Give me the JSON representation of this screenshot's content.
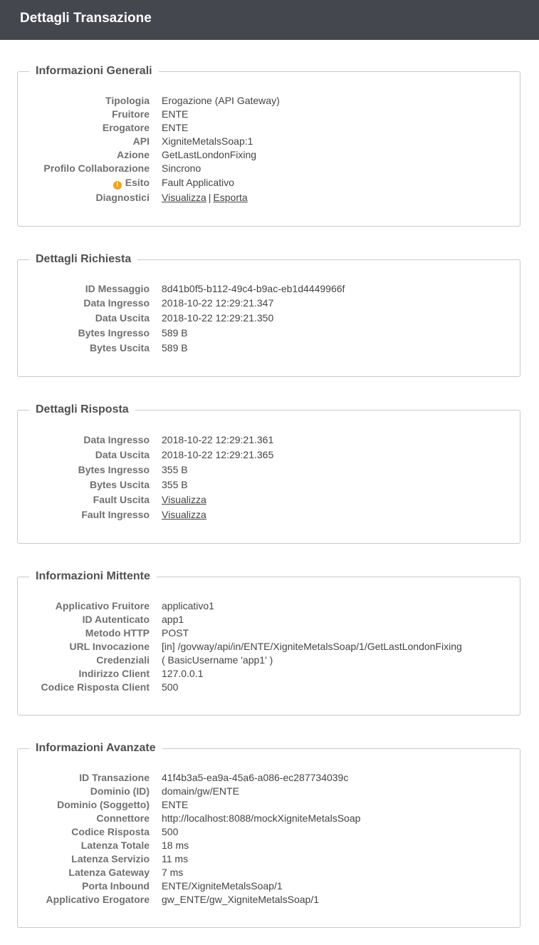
{
  "header": {
    "title": "Dettagli Transazione"
  },
  "generali": {
    "title": "Informazioni Generali",
    "tipologia": {
      "label": "Tipologia",
      "value": "Erogazione (API Gateway)"
    },
    "fruitore": {
      "label": "Fruitore",
      "value": "ENTE"
    },
    "erogatore": {
      "label": "Erogatore",
      "value": "ENTE"
    },
    "api": {
      "label": "API",
      "value": "XigniteMetalsSoap:1"
    },
    "azione": {
      "label": "Azione",
      "value": "GetLastLondonFixing"
    },
    "profilo": {
      "label": "Profilo Collaborazione",
      "value": "Sincrono"
    },
    "esito": {
      "label": "Esito",
      "value": "Fault Applicativo",
      "icon": "warning-icon",
      "icon_color": "#f0a51c"
    },
    "diagnostici": {
      "label": "Diagnostici",
      "link1": "Visualizza",
      "separator": "|",
      "link2": "Esporta"
    }
  },
  "richiesta": {
    "title": "Dettagli Richiesta",
    "id_messaggio": {
      "label": "ID Messaggio",
      "value": "8d41b0f5-b112-49c4-b9ac-eb1d4449966f"
    },
    "data_ingresso": {
      "label": "Data Ingresso",
      "value": "2018-10-22 12:29:21.347"
    },
    "data_uscita": {
      "label": "Data Uscita",
      "value": "2018-10-22 12:29:21.350"
    },
    "bytes_ingresso": {
      "label": "Bytes Ingresso",
      "value": "589 B"
    },
    "bytes_uscita": {
      "label": "Bytes Uscita",
      "value": "589 B"
    }
  },
  "risposta": {
    "title": "Dettagli Risposta",
    "data_ingresso": {
      "label": "Data Ingresso",
      "value": "2018-10-22 12:29:21.361"
    },
    "data_uscita": {
      "label": "Data Uscita",
      "value": "2018-10-22 12:29:21.365"
    },
    "bytes_ingresso": {
      "label": "Bytes Ingresso",
      "value": "355 B"
    },
    "bytes_uscita": {
      "label": "Bytes Uscita",
      "value": "355 B"
    },
    "fault_uscita": {
      "label": "Fault Uscita",
      "link": "Visualizza"
    },
    "fault_ingresso": {
      "label": "Fault Ingresso",
      "link": "Visualizza"
    }
  },
  "mittente": {
    "title": "Informazioni Mittente",
    "applicativo_fruitore": {
      "label": "Applicativo Fruitore",
      "value": "applicativo1"
    },
    "id_autenticato": {
      "label": "ID Autenticato",
      "value": "app1"
    },
    "metodo_http": {
      "label": "Metodo HTTP",
      "value": "POST"
    },
    "url_invocazione": {
      "label": "URL Invocazione",
      "value": "[in] /govway/api/in/ENTE/XigniteMetalsSoap/1/GetLastLondonFixing"
    },
    "credenziali": {
      "label": "Credenziali",
      "value": "( BasicUsername 'app1' )"
    },
    "indirizzo_client": {
      "label": "Indirizzo Client",
      "value": "127.0.0.1"
    },
    "codice_risposta_client": {
      "label": "Codice Risposta Client",
      "value": "500"
    }
  },
  "avanzate": {
    "title": "Informazioni Avanzate",
    "id_transazione": {
      "label": "ID Transazione",
      "value": "41f4b3a5-ea9a-45a6-a086-ec287734039c"
    },
    "dominio_id": {
      "label": "Dominio (ID)",
      "value": "domain/gw/ENTE"
    },
    "dominio_soggetto": {
      "label": "Dominio (Soggetto)",
      "value": "ENTE"
    },
    "connettore": {
      "label": "Connettore",
      "value": "http://localhost:8088/mockXigniteMetalsSoap"
    },
    "codice_risposta": {
      "label": "Codice Risposta",
      "value": "500"
    },
    "latenza_totale": {
      "label": "Latenza Totale",
      "value": "18 ms"
    },
    "latenza_servizio": {
      "label": "Latenza Servizio",
      "value": "11 ms"
    },
    "latenza_gateway": {
      "label": "Latenza Gateway",
      "value": "7 ms"
    },
    "porta_inbound": {
      "label": "Porta Inbound",
      "value": "ENTE/XigniteMetalsSoap/1"
    },
    "applicativo_erogatore": {
      "label": "Applicativo Erogatore",
      "value": "gw_ENTE/gw_XigniteMetalsSoap/1"
    }
  }
}
